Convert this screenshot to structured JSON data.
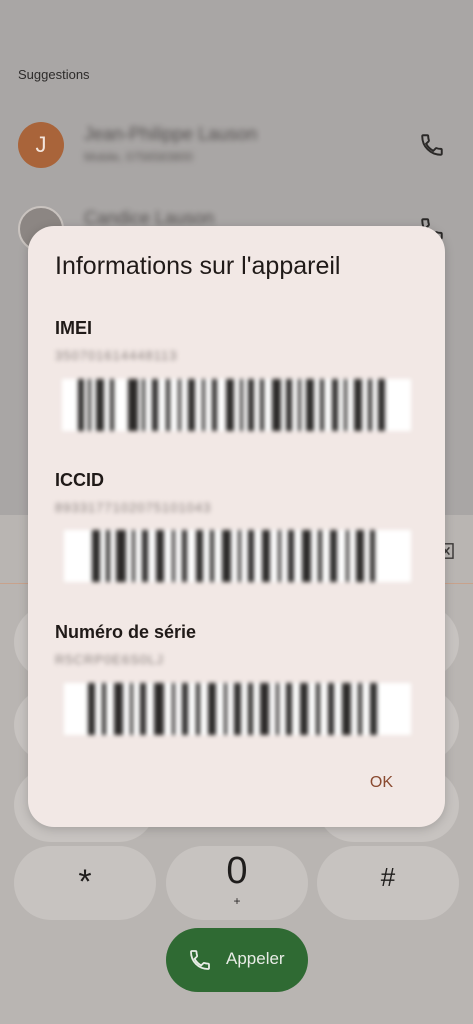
{
  "background": {
    "suggestions_label": "Suggestions",
    "contacts": [
      {
        "initial": "J",
        "name": "Jean-Philippe Lauson",
        "detail": "Mobile, 0756583800"
      },
      {
        "initial": "",
        "name": "Candice Lauson",
        "detail": ""
      }
    ],
    "keypad": {
      "star": "*",
      "zero": "0",
      "zero_sub": "+",
      "hash": "#"
    },
    "call_button_label": "Appeler",
    "colors": {
      "accent_green": "#2f6a33",
      "avatar_orange": "#a9643a"
    }
  },
  "dialog": {
    "title": "Informations sur l'appareil",
    "sections": [
      {
        "label": "IMEI",
        "value": "350701614448113"
      },
      {
        "label": "ICCID",
        "value": "8933177102075101043"
      },
      {
        "label": "Numéro de série",
        "value": "R5CRP0E6S0LJ"
      }
    ],
    "ok_label": "OK",
    "colors": {
      "surface": "#f2e8e5",
      "ok_text": "#8a4a30"
    }
  }
}
